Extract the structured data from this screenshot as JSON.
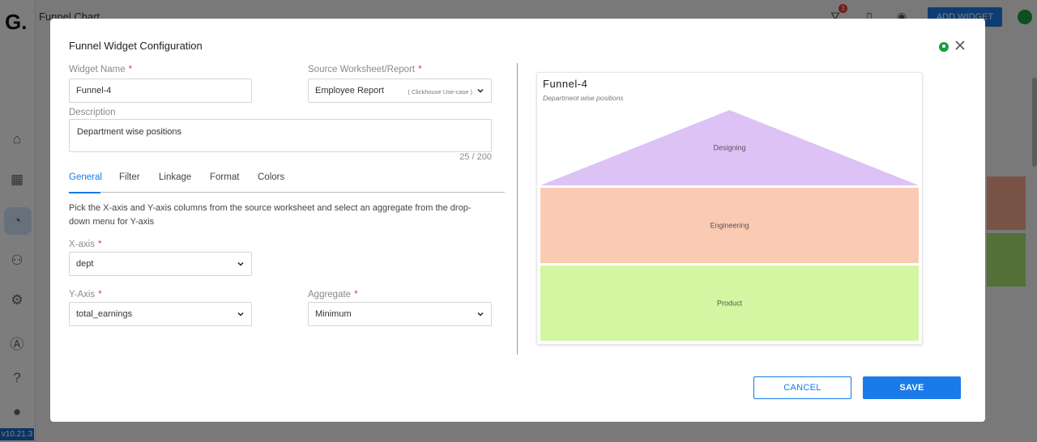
{
  "background": {
    "logo": "G.",
    "page_title": "Funnel Chart",
    "add_widget_label": "ADD WIDGET",
    "filter_badge_count": "3",
    "version": "v10.21.3"
  },
  "modal": {
    "title": "Funnel Widget Configuration",
    "widget_name": {
      "label": "Widget Name",
      "required_mark": "*",
      "value": "Funnel-4"
    },
    "source": {
      "label": "Source Worksheet/Report",
      "required_mark": "*",
      "value": "Employee Report",
      "note": "( Clickhouse Use-case )"
    },
    "description": {
      "label": "Description",
      "value": "Department wise positions",
      "counter": "25 / 200"
    },
    "tabs": [
      {
        "label": "General",
        "active": true
      },
      {
        "label": "Filter",
        "active": false
      },
      {
        "label": "Linkage",
        "active": false
      },
      {
        "label": "Format",
        "active": false
      },
      {
        "label": "Colors",
        "active": false
      }
    ],
    "help_text": "Pick the X-axis and Y-axis columns from the source worksheet and select an aggregate from the drop-down menu for Y-axis",
    "x_axis": {
      "label": "X-axis",
      "required_mark": "*",
      "value": "dept"
    },
    "y_axis": {
      "label": "Y-Axis",
      "required_mark": "*",
      "value": "total_earnings"
    },
    "aggregate": {
      "label": "Aggregate",
      "required_mark": "*",
      "value": "Minimum"
    },
    "cancel_label": "CANCEL",
    "save_label": "SAVE"
  },
  "preview": {
    "title": "Funnel-4",
    "subtitle": "Department wise positions"
  },
  "chart_data": {
    "type": "funnel",
    "categories": [
      "Designing",
      "Engineering",
      "Product"
    ],
    "colors": [
      "#dcc2f5",
      "#fbcab3",
      "#d3f6a3"
    ]
  },
  "colors": {
    "accent": "#1a7ae8",
    "required": "#e53935",
    "help_green": "#1b9e3e"
  }
}
